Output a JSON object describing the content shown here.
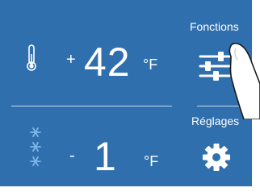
{
  "fridge": {
    "sign": "+",
    "value": "42",
    "unit": "°F",
    "icon": "thermometer-icon"
  },
  "freezer": {
    "sign": "-",
    "value": "1",
    "unit": "°F",
    "icon": "snowflake-icon"
  },
  "functions": {
    "label": "Fonctions",
    "icon": "sliders-icon"
  },
  "settings": {
    "label": "Réglages",
    "icon": "gear-icon"
  },
  "colors": {
    "panel": "#2f6fad",
    "freezer_icon": "#7fb6e6",
    "foreground": "#ffffff"
  }
}
